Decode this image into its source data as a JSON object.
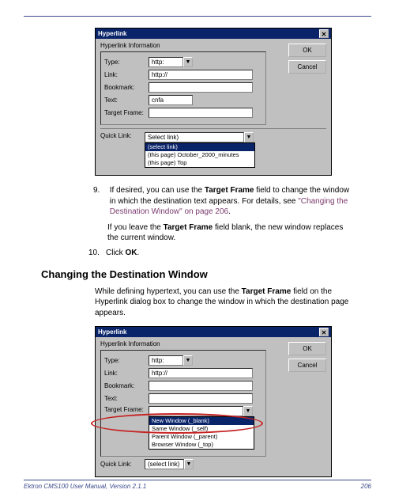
{
  "dialog1": {
    "title": "Hyperlink",
    "groupLabel": "Hyperlink Information",
    "typeLabel": "Type:",
    "typeValue": "http:",
    "linkLabel": "Link:",
    "linkValue": "http://",
    "bookmarkLabel": "Bookmark:",
    "textLabel": "Text:",
    "textValue": "cnfa",
    "targetFrameLabel": "Target Frame:",
    "targetFrameValue": "",
    "quickLinkLabel": "Quick Link:",
    "quickLinkSelected": "Select link)",
    "quickLinkOptions": [
      "(select link)",
      "(this page) October_2000_minutes",
      "(this page) Top"
    ],
    "okLabel": "OK",
    "cancelLabel": "Cancel"
  },
  "step9": {
    "num": "9.",
    "text1a": "If desired, you can use the ",
    "targetFrameBold": "Target Frame",
    "text1b": " field to change the window in which the destination text appears. For details, see ",
    "linkText": "\"Changing the Destination Window\" on page 206",
    "dot": ".",
    "text2a": "If you leave the ",
    "text2b": " field blank, the new window replaces the current window."
  },
  "step10": {
    "num": "10.",
    "textA": "Click ",
    "okBold": "OK",
    "dot": "."
  },
  "heading": "Changing the Destination Window",
  "para1a": "While defining hypertext, you can use the ",
  "para1b": " field on the Hyperlink dialog box to change the window in which the destination page appears.",
  "dialog2": {
    "title": "Hyperlink",
    "groupLabel": "Hyperlink Information",
    "typeLabel": "Type:",
    "typeValue": "http:",
    "linkLabel": "Link:",
    "linkValue": "http://",
    "bookmarkLabel": "Bookmark:",
    "textLabel": "Text:",
    "textValue": "",
    "targetFrameLabel": "Target Frame:",
    "targetFrameValue": "",
    "targetOptions": [
      "New Window (_blank)",
      "Same Window (_self)",
      "Parent Window (_parent)",
      "Browser Window (_top)"
    ],
    "quickLinkLabel": "Quick Link:",
    "quickLinkValue": "(select link)",
    "okLabel": "OK",
    "cancelLabel": "Cancel"
  },
  "footer": {
    "left": "Ektron CMS100 User Manual, Version 2.1.1",
    "right": "206"
  }
}
